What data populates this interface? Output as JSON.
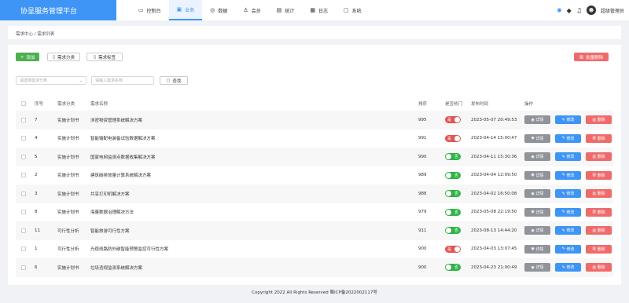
{
  "app": {
    "title": "协呈服务管理平台"
  },
  "nav": [
    {
      "icon": "monitor-icon",
      "glyph": "▭",
      "label": "控制台"
    },
    {
      "icon": "briefcase-icon",
      "glyph": "▣",
      "label": "业务"
    },
    {
      "icon": "database-icon",
      "glyph": "◎",
      "label": "数据"
    },
    {
      "icon": "user-icon",
      "glyph": "♙",
      "label": "会员"
    },
    {
      "icon": "chart-icon",
      "glyph": "▤",
      "label": "统计"
    },
    {
      "icon": "log-icon",
      "glyph": "▦",
      "label": "日志"
    },
    {
      "icon": "system-icon",
      "glyph": "▢",
      "label": "系统"
    }
  ],
  "active_nav": "业务",
  "user": {
    "name": "超级管理员"
  },
  "breadcrumb": [
    "需求中心",
    "需求列表"
  ],
  "toolbar": {
    "add_label": "添加",
    "category_label": "需求分类",
    "tags_label": "需求标签",
    "batch_delete_label": "批量删除"
  },
  "filters": {
    "category_placeholder": "请选择需求分类",
    "name_placeholder": "请输入需求名称",
    "search_label": "查找"
  },
  "table": {
    "headers": [
      "序号",
      "需求分类",
      "需求名称",
      "排序",
      "是否热门",
      "发布时间",
      "操作"
    ],
    "actions": {
      "detail": "详情",
      "edit": "修改",
      "delete": "删除"
    },
    "rows": [
      {
        "id": "7",
        "category": "实施计划书",
        "name": "涉密物资管理系统解决方案",
        "sort": "995",
        "hot": "是",
        "time": "2023-05-07 20:49:53"
      },
      {
        "id": "4",
        "category": "实施计划书",
        "name": "智能输配电装备试验数据解决方案",
        "sort": "991",
        "hot": "是",
        "time": "2023-04-14 15:00:47"
      },
      {
        "id": "5",
        "category": "实施计划书",
        "name": "国家电网监测点数据收集解决方案",
        "sort": "990",
        "hot": "否",
        "time": "2023-04-11 15:30:36"
      },
      {
        "id": "2",
        "category": "实施计划书",
        "name": "建筑碳排放量计算系统解决方案",
        "sort": "989",
        "hot": "否",
        "time": "2023-04-04 12:09:50"
      },
      {
        "id": "3",
        "category": "实施计划书",
        "name": "共享打印机解决方案",
        "sort": "988",
        "hot": "否",
        "time": "2023-04-02 16:50:08"
      },
      {
        "id": "8",
        "category": "实施计划书",
        "name": "海量数据治理解决方法",
        "sort": "979",
        "hot": "否",
        "time": "2023-05-08 22:19:50"
      },
      {
        "id": "11",
        "category": "可行性分析",
        "name": "智能旅游可行性方案",
        "sort": "911",
        "hot": "否",
        "time": "2023-08-13 14:44:20"
      },
      {
        "id": "1",
        "category": "可行性分析",
        "name": "光缆线路防外破智能预警监控可行性方案",
        "sort": "900",
        "hot": "是",
        "time": "2023-04-03 13:07:45"
      },
      {
        "id": "6",
        "category": "实施计划书",
        "name": "垃圾违规监测系统解决方案",
        "sort": "900",
        "hot": "否",
        "time": "2023-04-23 21:00:49"
      }
    ]
  },
  "footer": {
    "text": "Copyright 2022 All Rights Reserved 蜀ICP备2022002117号"
  }
}
